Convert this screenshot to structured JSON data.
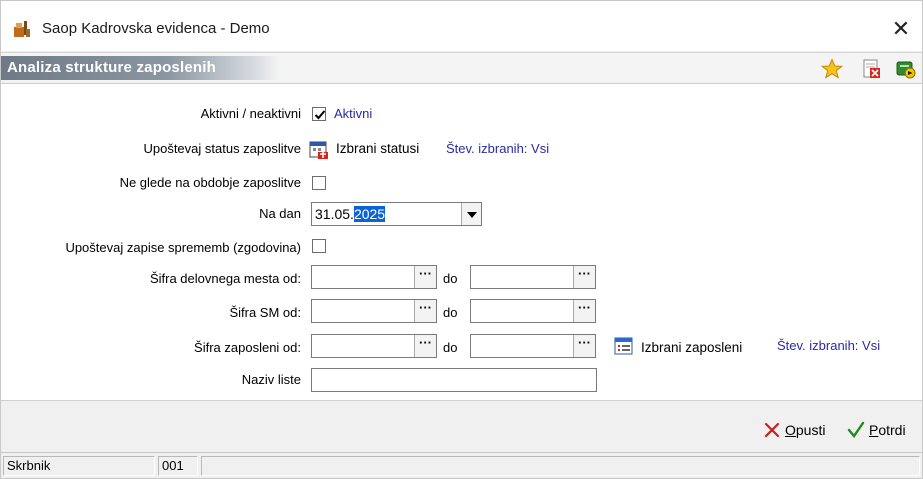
{
  "window": {
    "title": "Saop Kadrovska evidenca - Demo",
    "close_label": "✕"
  },
  "header": {
    "title": "Analiza strukture zaposlenih",
    "icons": [
      "star-icon",
      "delete-document-icon",
      "run-icon"
    ]
  },
  "form": {
    "aktivni_label": "Aktivni / neaktivni",
    "aktivni_checked": true,
    "aktivni_value": "Aktivni",
    "status_label": "Upoštevaj status zaposlitve",
    "status_button": "Izbrani statusi",
    "status_count": "Štev. izbranih: Vsi",
    "obdobje_label": "Ne glede na obdobje zaposlitve",
    "obdobje_checked": false,
    "na_dan_label": "Na dan",
    "na_dan_prefix": "31.05.",
    "na_dan_selected": "2025",
    "zgodovina_label": "Upoštevaj zapise sprememb (zgodovina)",
    "zgodovina_checked": false,
    "delovno_mesto_label": "Šifra delovnega mesta od:",
    "sm_label": "Šifra SM od:",
    "zaposleni_label": "Šifra zaposleni od:",
    "do_label": "do",
    "ellipsis": "···",
    "zaposleni_button": "Izbrani zaposleni",
    "zaposleni_count": "Štev. izbranih: Vsi",
    "naziv_label": "Naziv liste",
    "naziv_value": ""
  },
  "actions": {
    "cancel_label": "Opusti",
    "cancel_mnemonic": "O",
    "cancel_rest": "pusti",
    "confirm_label": "Potrdi",
    "confirm_mnemonic": "P",
    "confirm_rest": "otrdi"
  },
  "status": {
    "user": "Skrbnik",
    "code": "001",
    "extra": ""
  }
}
